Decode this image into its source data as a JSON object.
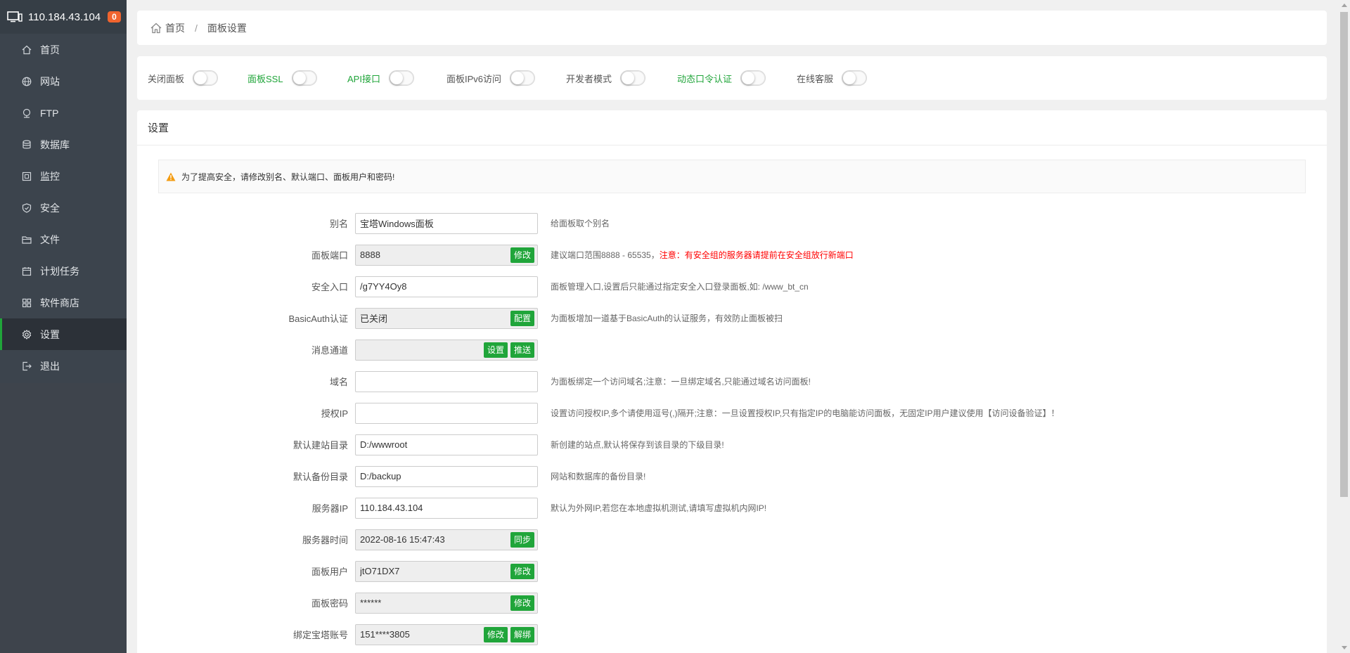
{
  "sidebar": {
    "host": "110.184.43.104",
    "badge": "0",
    "items": [
      {
        "label": "首页",
        "icon": "home-icon"
      },
      {
        "label": "网站",
        "icon": "globe-icon"
      },
      {
        "label": "FTP",
        "icon": "ftp-icon"
      },
      {
        "label": "数据库",
        "icon": "database-icon"
      },
      {
        "label": "监控",
        "icon": "monitor-icon"
      },
      {
        "label": "安全",
        "icon": "shield-icon"
      },
      {
        "label": "文件",
        "icon": "folder-icon"
      },
      {
        "label": "计划任务",
        "icon": "calendar-icon"
      },
      {
        "label": "软件商店",
        "icon": "apps-icon"
      },
      {
        "label": "设置",
        "icon": "gear-icon",
        "active": true
      },
      {
        "label": "退出",
        "icon": "logout-icon"
      }
    ]
  },
  "breadcrumb": {
    "home": "首页",
    "separator": "/",
    "current": "面板设置"
  },
  "toggles": [
    {
      "label": "关闭面板",
      "color": "default"
    },
    {
      "label": "面板SSL",
      "color": "green"
    },
    {
      "label": "API接口",
      "color": "green"
    },
    {
      "label": "面板IPv6访问",
      "color": "default"
    },
    {
      "label": "开发者模式",
      "color": "default"
    },
    {
      "label": "动态口令认证",
      "color": "green"
    },
    {
      "label": "在线客服",
      "color": "default"
    }
  ],
  "settings": {
    "title": "设置",
    "warning": "为了提高安全，请修改别名、默认端口、面板用户和密码!",
    "rows": {
      "alias": {
        "label": "别名",
        "value": "宝塔Windows面板",
        "hint": "给面板取个别名"
      },
      "port": {
        "label": "面板端口",
        "value": "8888",
        "btn": "修改",
        "hint": "建议端口范围8888 - 65535，",
        "hint_red": "注意：有安全组的服务器请提前在安全组放行新端口"
      },
      "entry": {
        "label": "安全入口",
        "value": "/g7YY4Oy8",
        "hint": "面板管理入口,设置后只能通过指定安全入口登录面板,如: /www_bt_cn"
      },
      "basicauth": {
        "label": "BasicAuth认证",
        "value": "已关闭",
        "btn": "配置",
        "hint": "为面板增加一道基于BasicAuth的认证服务，有效防止面板被扫"
      },
      "message": {
        "label": "消息通道",
        "value": "",
        "btn1": "设置",
        "btn2": "推送"
      },
      "domain": {
        "label": "域名",
        "value": "",
        "hint": "为面板绑定一个访问域名;注意：一旦绑定域名,只能通过域名访问面板!"
      },
      "authip": {
        "label": "授权IP",
        "value": "",
        "hint": "设置访问授权IP,多个请使用逗号(,)隔开;注意：一旦设置授权IP,只有指定IP的电脑能访问面板，无固定IP用户建议使用【访问设备验证】！"
      },
      "sitedir": {
        "label": "默认建站目录",
        "value": "D:/wwwroot",
        "hint": "新创建的站点,默认将保存到该目录的下级目录!"
      },
      "backupdir": {
        "label": "默认备份目录",
        "value": "D:/backup",
        "hint": "网站和数据库的备份目录!"
      },
      "serverip": {
        "label": "服务器IP",
        "value": "110.184.43.104",
        "hint": "默认为外网IP,若您在本地虚拟机测试,请填写虚拟机内网IP!"
      },
      "servertime": {
        "label": "服务器时间",
        "value": "2022-08-16 15:47:43",
        "btn": "同步"
      },
      "user": {
        "label": "面板用户",
        "value": "jtO71DX7",
        "btn": "修改"
      },
      "password": {
        "label": "面板密码",
        "value": "******",
        "btn": "修改"
      },
      "account": {
        "label": "绑定宝塔账号",
        "value": "151****3805",
        "btn1": "修改",
        "btn2": "解绑"
      }
    }
  },
  "colors": {
    "accent": "#20a53a",
    "sidebar": "#3c444d",
    "badge": "#f0642e",
    "warning": "#f39c12",
    "danger": "#ff0000"
  }
}
